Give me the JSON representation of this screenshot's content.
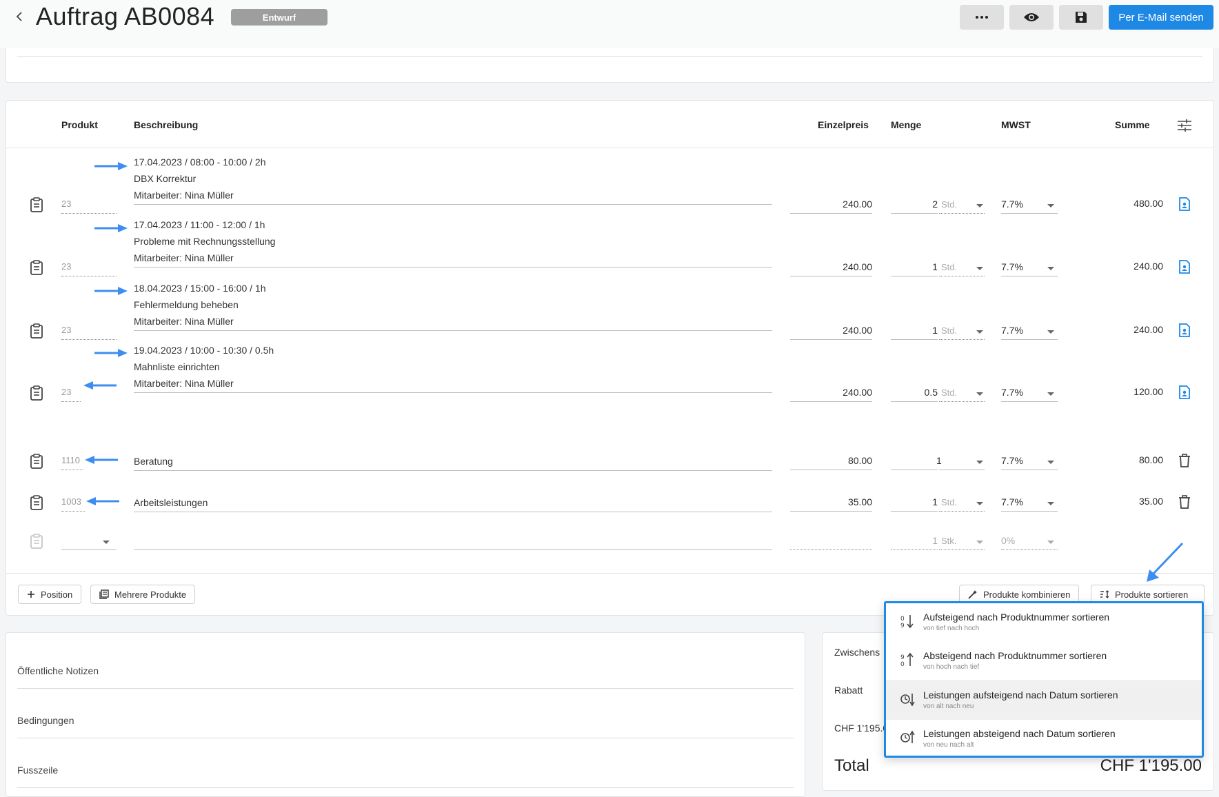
{
  "header": {
    "title": "Auftrag AB0084",
    "status": "Entwurf",
    "email_button": "Per E-Mail senden"
  },
  "table": {
    "columns": {
      "product": "Produkt",
      "description": "Beschreibung",
      "unit_price": "Einzelpreis",
      "quantity": "Menge",
      "vat": "MWST",
      "sum": "Summe"
    },
    "rows": [
      {
        "product": "23",
        "lines": [
          "17.04.2023 / 08:00 - 10:00 / 2h",
          "DBX Korrektur",
          "Mitarbeiter: Nina Müller"
        ],
        "price": "240.00",
        "qty": "2",
        "unit": "Std.",
        "vat": "7.7%",
        "sum": "480.00",
        "action_icon": "document-person-icon"
      },
      {
        "product": "23",
        "lines": [
          "17.04.2023 / 11:00 - 12:00 / 1h",
          "Probleme mit Rechnungsstellung",
          "Mitarbeiter: Nina Müller"
        ],
        "price": "240.00",
        "qty": "1",
        "unit": "Std.",
        "vat": "7.7%",
        "sum": "240.00",
        "action_icon": "document-person-icon"
      },
      {
        "product": "23",
        "lines": [
          "18.04.2023 / 15:00 - 16:00 / 1h",
          "Fehlermeldung beheben",
          "Mitarbeiter: Nina Müller"
        ],
        "price": "240.00",
        "qty": "1",
        "unit": "Std.",
        "vat": "7.7%",
        "sum": "240.00",
        "action_icon": "document-person-icon"
      },
      {
        "product": "23",
        "lines": [
          "19.04.2023 / 10:00 - 10:30 / 0.5h",
          "Mahnliste einrichten",
          "Mitarbeiter: Nina Müller"
        ],
        "price": "240.00",
        "qty": "0.5",
        "unit": "Std.",
        "vat": "7.7%",
        "sum": "120.00",
        "action_icon": "document-person-icon"
      },
      {
        "product": "1110",
        "lines": [
          "Beratung"
        ],
        "price": "80.00",
        "qty": "1",
        "unit": "",
        "vat": "7.7%",
        "sum": "80.00",
        "action_icon": "trash-icon"
      },
      {
        "product": "1003",
        "lines": [
          "Arbeitsleistungen"
        ],
        "price": "35.00",
        "qty": "1",
        "unit": "Std.",
        "vat": "7.7%",
        "sum": "35.00",
        "action_icon": "trash-icon"
      }
    ],
    "empty_row": {
      "qty": "1",
      "unit": "Stk.",
      "vat": "0%"
    }
  },
  "footer_buttons": {
    "add_position": "Position",
    "multiple_products": "Mehrere Produkte",
    "combine_products": "Produkte kombinieren",
    "sort_products": "Produkte sortieren"
  },
  "sort_menu": {
    "items": [
      {
        "title": "Aufsteigend nach Produktnummer sortieren",
        "subtitle": "von tief nach hoch",
        "icon": "sort-numeric-asc-icon"
      },
      {
        "title": "Absteigend nach Produktnummer sortieren",
        "subtitle": "von hoch nach tief",
        "icon": "sort-numeric-desc-icon"
      },
      {
        "title": "Leistungen aufsteigend nach Datum sortieren",
        "subtitle": "von alt nach neu",
        "icon": "sort-date-asc-icon"
      },
      {
        "title": "Leistungen absteigend nach Datum sortieren",
        "subtitle": "von neu nach alt",
        "icon": "sort-date-desc-icon"
      }
    ]
  },
  "notes": {
    "public_notes": "Öffentliche Notizen",
    "conditions": "Bedingungen",
    "footer": "Fusszeile"
  },
  "totals": {
    "subtotal_label": "Zwischens",
    "discount_label": "Rabatt",
    "amount_partial": "CHF 1'195.0",
    "total_label": "Total",
    "total_value": "CHF 1'195.00"
  },
  "colors": {
    "accent": "#1e88e5",
    "badge": "#9e9e9e",
    "annotation_arrow": "#3d8ef0"
  }
}
